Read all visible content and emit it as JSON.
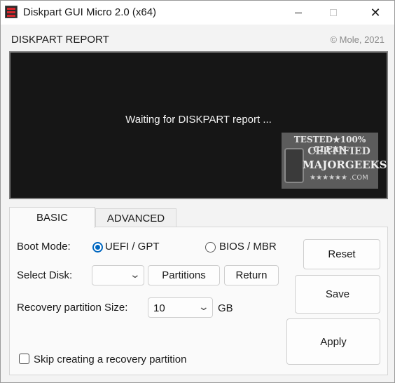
{
  "window": {
    "title": "Diskpart GUI Micro 2.0 (x64)",
    "controls": {
      "minimize": "minimize-icon",
      "maximize": "maximize-icon",
      "close": "✕"
    }
  },
  "header": {
    "report_label": "DISKPART REPORT",
    "copyright": "© Mole, 2021"
  },
  "report": {
    "status_text": "Waiting for DISKPART report ...",
    "badge": {
      "line1": "TESTED★100% CLEAN",
      "line2": "CERTIFIED",
      "line3": "MAJORGEEKS",
      "line4": "★★★★★★ .COM"
    }
  },
  "tabs": [
    {
      "label": "BASIC",
      "active": true
    },
    {
      "label": "ADVANCED",
      "active": false
    }
  ],
  "basic": {
    "boot_mode_label": "Boot Mode:",
    "boot_options": [
      {
        "label": "UEFI / GPT",
        "selected": true
      },
      {
        "label": "BIOS / MBR",
        "selected": false
      }
    ],
    "select_disk_label": "Select Disk:",
    "select_disk_value": "",
    "partitions_button": "Partitions",
    "return_button": "Return",
    "recovery_size_label": "Recovery partition Size:",
    "recovery_size_value": "10",
    "recovery_size_unit": "GB",
    "skip_recovery_label": "Skip creating a recovery partition",
    "skip_recovery_checked": false
  },
  "actions": {
    "reset": "Reset",
    "save": "Save",
    "apply": "Apply"
  },
  "colors": {
    "accent": "#0067c0",
    "report_bg": "#161616",
    "window_bg": "#f3f3f3"
  }
}
